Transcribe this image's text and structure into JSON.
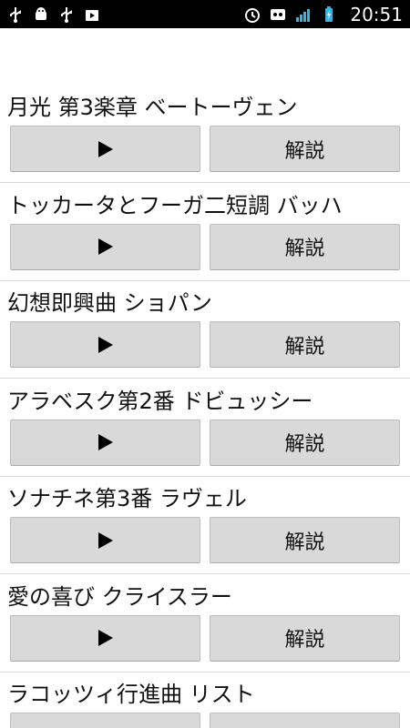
{
  "status_bar": {
    "time": "20:51",
    "network": "LTE",
    "left_icons": [
      "usb-icon",
      "android-debug-icon",
      "usb-icon",
      "play-store-icon"
    ],
    "right_icons": [
      "alarm-icon",
      "notification-icon",
      "signal-icon",
      "battery-charging-icon"
    ]
  },
  "items": [
    {
      "title": "月光 第3楽章 ベートーヴェン",
      "info_label": "解説"
    },
    {
      "title": "トッカータとフーガ二短調 バッハ",
      "info_label": "解説"
    },
    {
      "title": "幻想即興曲 ショパン",
      "info_label": "解説"
    },
    {
      "title": "アラベスク第2番 ドビュッシー",
      "info_label": "解説"
    },
    {
      "title": "ソナチネ第3番 ラヴェル",
      "info_label": "解説"
    },
    {
      "title": "愛の喜び クライスラー",
      "info_label": "解説"
    },
    {
      "title": "ラコッツィ行進曲 リスト",
      "info_label": ""
    }
  ]
}
